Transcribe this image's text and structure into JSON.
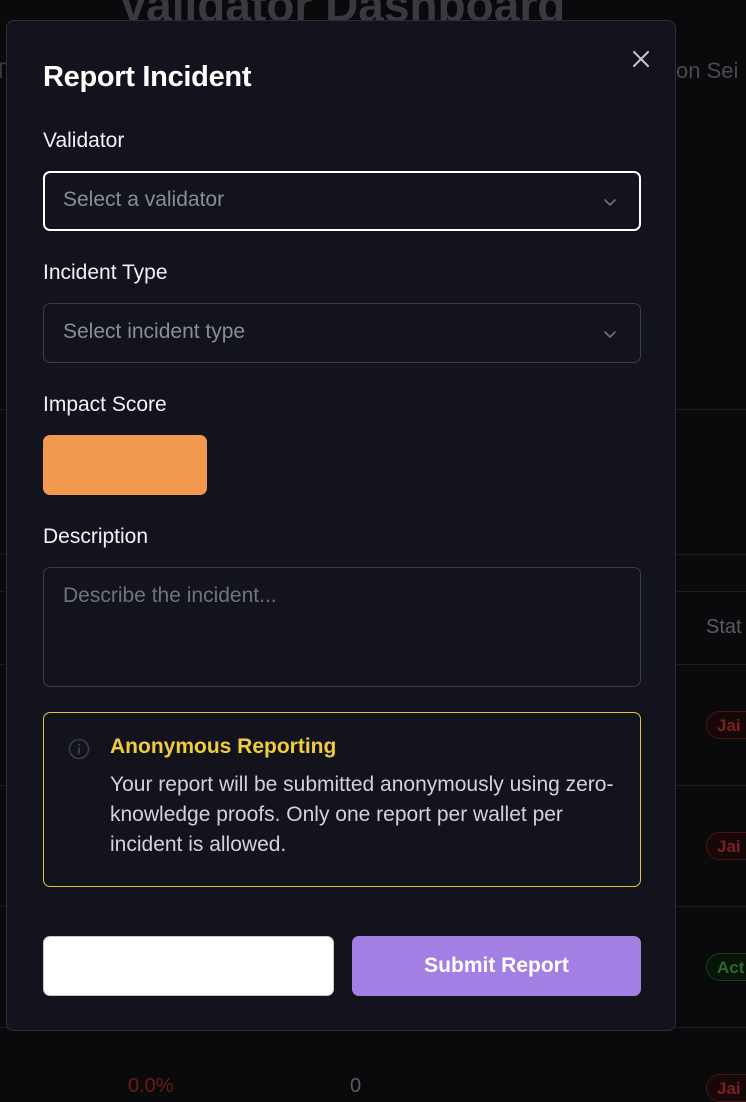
{
  "background": {
    "page_title": "Validator Dashboard",
    "subtitle_left": "Ti",
    "subtitle_right": "on Sei",
    "table_header_status": "Stat",
    "status_pills": [
      "Jai",
      "Jai",
      "Act",
      "Jai"
    ],
    "bottom_row": {
      "percent": "0.0%",
      "count": "0"
    }
  },
  "modal": {
    "title": "Report Incident",
    "close_icon": "close-icon",
    "validator": {
      "label": "Validator",
      "placeholder": "Select a validator"
    },
    "incident_type": {
      "label": "Incident Type",
      "placeholder": "Select incident type"
    },
    "impact_score": {
      "label": "Impact Score",
      "color": "#f0994f"
    },
    "description": {
      "label": "Description",
      "placeholder": "Describe the incident..."
    },
    "notice": {
      "icon": "info-icon",
      "title": "Anonymous Reporting",
      "body": "Your report will be submitted anonymously using zero-knowledge proofs. Only one report per wallet per incident is allowed."
    },
    "actions": {
      "cancel_label": "",
      "submit_label": "Submit Report"
    }
  },
  "colors": {
    "modal_bg": "#12131c",
    "submit_accent": "#a47fe3",
    "notice_border": "#e6c336",
    "notice_title": "#f1cd3c"
  }
}
